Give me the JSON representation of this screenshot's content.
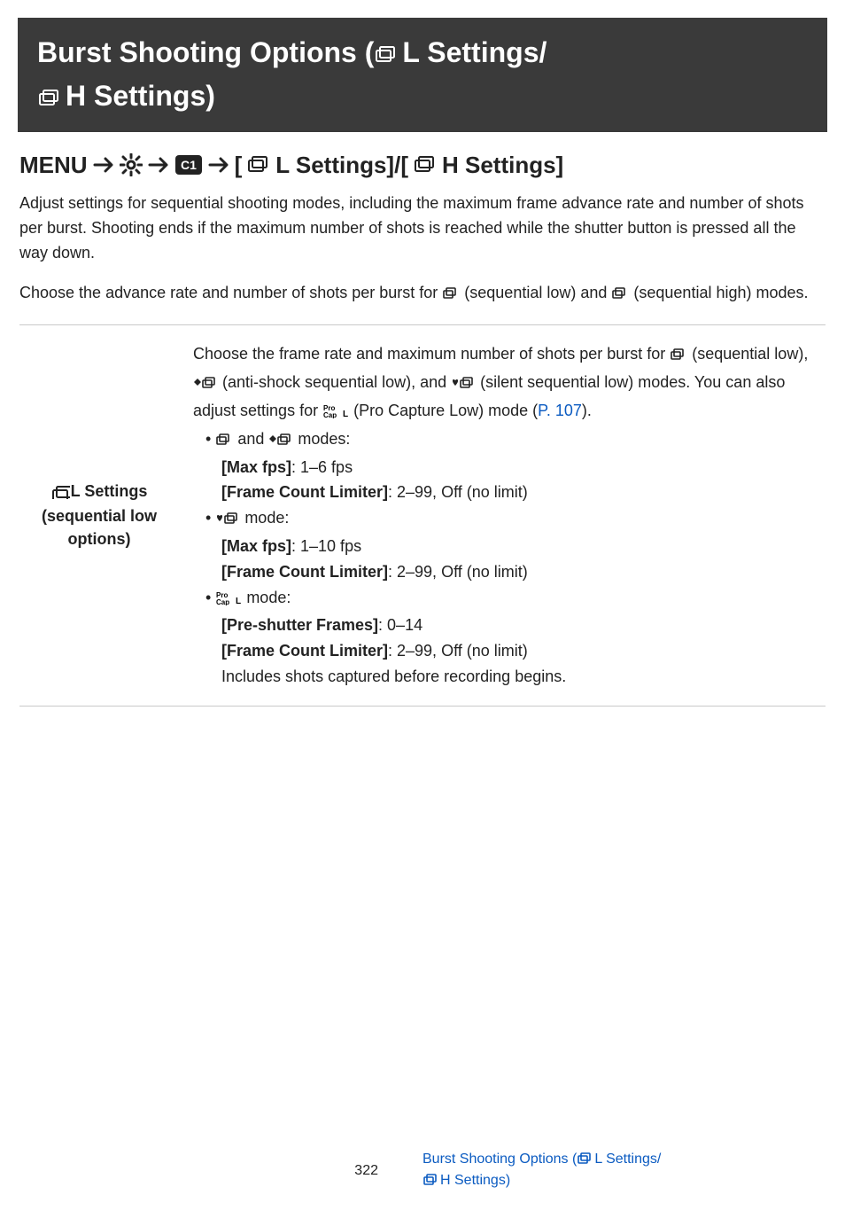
{
  "title": {
    "part1": "Burst Shooting Options (",
    "L": "L Settings/",
    "H": "H Settings)"
  },
  "subhead": {
    "menu": "MENU",
    "bracket_open": "[",
    "L": "L Settings]/[",
    "H": "H Settings]"
  },
  "para1": "Adjust settings for sequential shooting modes, including the maximum frame advance rate and number of shots per burst. Shooting ends if the maximum number of shots is reached while the shutter button is pressed all the way down.",
  "para2_a": "Choose the advance rate and number of shots per burst for ",
  "para2_b": " (sequential low) and ",
  "para2_c": " (sequential high) modes.",
  "row1": {
    "label_line1": "L Settings",
    "label_line2": "(sequential low",
    "label_line3": "options)",
    "intro_a": "Choose the frame rate and maximum number of shots per burst for ",
    "intro_b": " (sequential low), ",
    "intro_c": " (anti-shock sequential low), and ",
    "intro_d": " (silent sequential low) modes. You can also adjust settings for ",
    "intro_e": " (Pro Capture Low) mode (",
    "p107": "P. 107",
    "intro_f": ").",
    "b1_a": " and ",
    "b1_b": " modes:",
    "maxfps1_label": "[Max fps]",
    "maxfps1_val": ": 1–6 fps",
    "fcl1_label": "[Frame Count Limiter]",
    "fcl1_val": ": 2–99, Off (no limit)",
    "b2": " mode:",
    "maxfps2_label": "[Max fps]",
    "maxfps2_val": ": 1–10 fps",
    "fcl2_label": "[Frame Count Limiter]",
    "fcl2_val": ": 2–99, Off (no limit)",
    "b3": " mode:",
    "psf_label": "[Pre-shutter Frames]",
    "psf_val": ": 0–14",
    "fcl3_label": "[Frame Count Limiter]",
    "fcl3_val": ": 2–99, Off (no limit)",
    "includes": "Includes shots captured before recording begins."
  },
  "footer": {
    "page": "322",
    "link_a": "Burst Shooting Options (",
    "link_b": "L Settings/",
    "link_c": "H Settings)"
  }
}
